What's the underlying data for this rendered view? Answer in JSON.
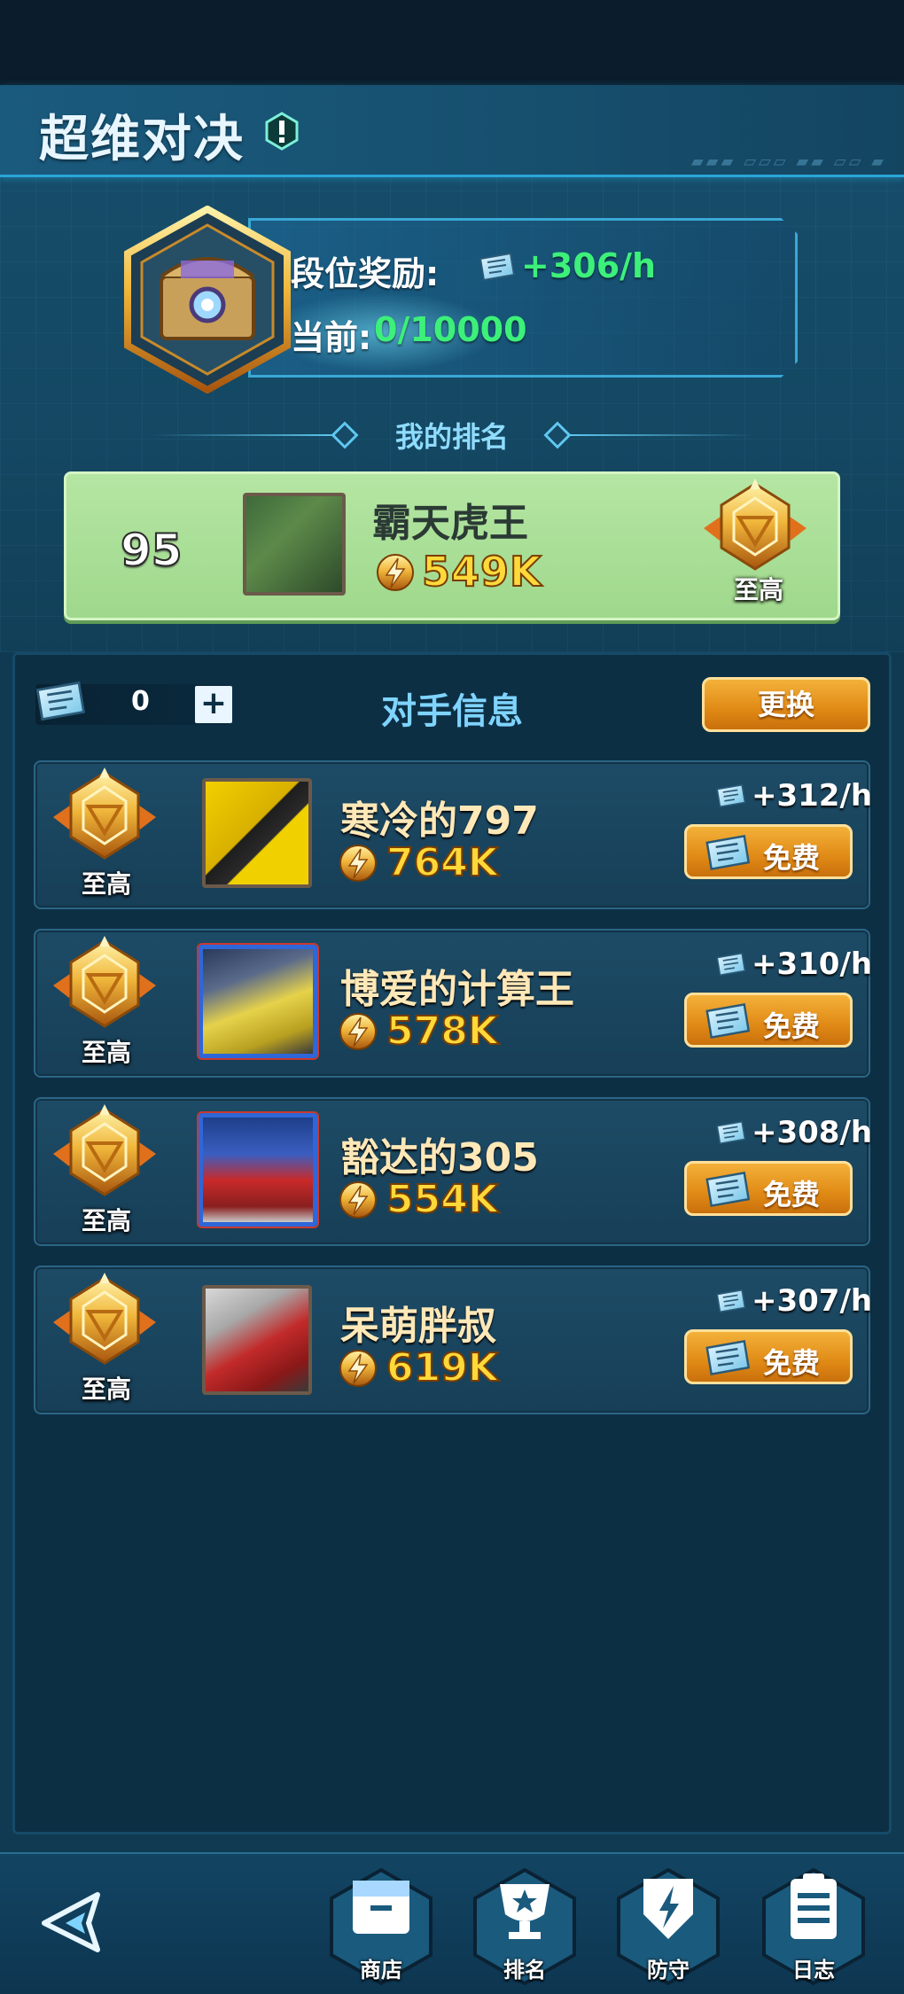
{
  "header": {
    "title": "超维对决"
  },
  "reward": {
    "label": "段位奖励:",
    "rate": "+306/h",
    "current_label": "当前:",
    "current_value": "0/10000"
  },
  "my_rank": {
    "heading": "我的排名",
    "rank": "95",
    "name": "霸天虎王",
    "power": "549K",
    "tier": "至高"
  },
  "opponents": {
    "ticket_count": "0",
    "plus_label": "+",
    "heading": "对手信息",
    "refresh_label": "更换",
    "items": [
      {
        "name": "寒冷的797",
        "power": "764K",
        "rate": "+312/h",
        "tier": "至高",
        "action": "免费"
      },
      {
        "name": "博爱的计算王",
        "power": "578K",
        "rate": "+310/h",
        "tier": "至高",
        "action": "免费"
      },
      {
        "name": "豁达的305",
        "power": "554K",
        "rate": "+308/h",
        "tier": "至高",
        "action": "免费"
      },
      {
        "name": "呆萌胖叔",
        "power": "619K",
        "rate": "+307/h",
        "tier": "至高",
        "action": "免费"
      }
    ]
  },
  "nav": {
    "items": [
      {
        "label": "商店",
        "icon": "shop-icon"
      },
      {
        "label": "排名",
        "icon": "trophy-icon"
      },
      {
        "label": "防守",
        "icon": "shield-icon"
      },
      {
        "label": "日志",
        "icon": "log-icon"
      }
    ]
  },
  "colors": {
    "accent_green": "#3cf07a",
    "gold": "#ffd93a",
    "button_orange": "#e08a16",
    "panel_blue": "#0d2f44"
  }
}
